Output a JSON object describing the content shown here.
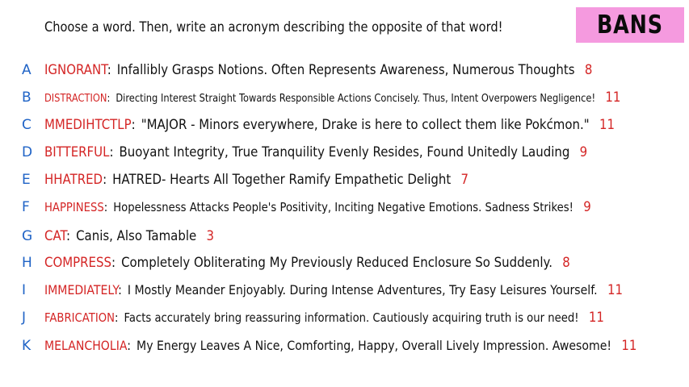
{
  "prompt": "Choose a word. Then, write an acronym describing the opposite of that word!",
  "badge": "BANS",
  "colors": {
    "letter": "#1f63c6",
    "word": "#d42525",
    "badge_bg": "#f59adf",
    "text": "#111111"
  },
  "entries": [
    {
      "letter": "A",
      "word": "IGNORANT",
      "phrase": "Infallibly Grasps Notions. Often Represents Awareness, Numerous Thoughts",
      "count": "8"
    },
    {
      "letter": "B",
      "word": "DISTRACTION",
      "phrase": "Directing Interest Straight Towards Responsible Actions Concisely. Thus, Intent Overpowers Negligence!",
      "count": "11"
    },
    {
      "letter": "C",
      "word": "MMEDIHTCTLP",
      "phrase": "\"MAJOR - Minors everywhere, Drake is here to collect them like Pokćmon.\"",
      "count": "11"
    },
    {
      "letter": "D",
      "word": "BITTERFUL",
      "phrase": "Buoyant Integrity, True Tranquility Evenly Resides, Found Unitedly Lauding",
      "count": "9"
    },
    {
      "letter": "E",
      "word": "HHATRED",
      "phrase": "HATRED- Hearts All Together Ramify Empathetic Delight",
      "count": "7"
    },
    {
      "letter": "F",
      "word": "HAPPINESS",
      "phrase": "Hopelessness Attacks People's Positivity, Inciting Negative Emotions. Sadness Strikes!",
      "count": "9"
    },
    {
      "letter": "G",
      "word": "CAT",
      "phrase": "Canis, Also Tamable",
      "count": "3"
    },
    {
      "letter": "H",
      "word": "COMPRESS",
      "phrase": "Completely Obliterating My Previously Reduced Enclosure So Suddenly.",
      "count": "8"
    },
    {
      "letter": "I",
      "word": "IMMEDIATELY",
      "phrase": "I Mostly Meander Enjoyably. During Intense Adventures, Try Easy Leisures Yourself.",
      "count": "11"
    },
    {
      "letter": "J",
      "word": "FABRICATION",
      "phrase": "Facts accurately bring reassuring information. Cautiously acquiring truth is our need!",
      "count": "11"
    },
    {
      "letter": "K",
      "word": "MELANCHOLIA",
      "phrase": "My Energy Leaves A Nice, Comforting, Happy, Overall Lively Impression. Awesome!",
      "count": "11"
    }
  ]
}
